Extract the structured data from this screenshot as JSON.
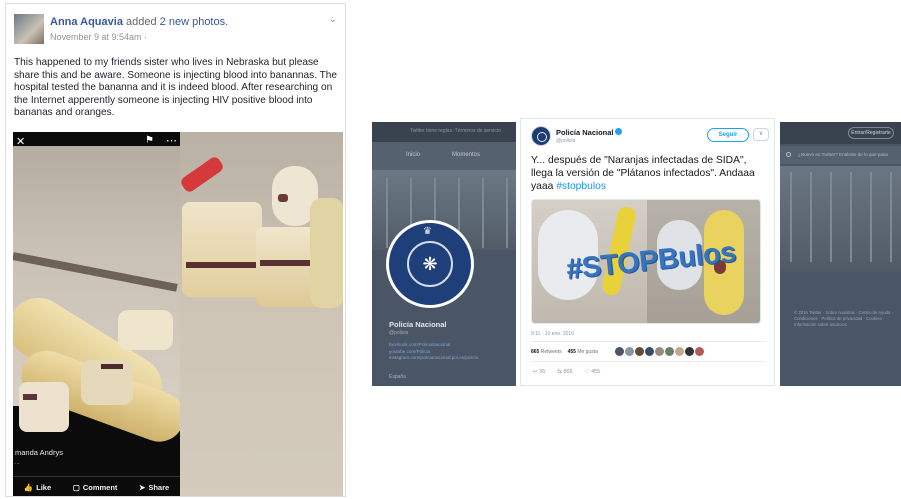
{
  "facebook_post": {
    "author": "Anna Aquavia",
    "action": "added",
    "photos_link": "2 new photos.",
    "timestamp": "November 9 at 9:54am ·",
    "body": "This happened to my friends sister who lives in Nebraska but please share this and be aware. Someone is injecting blood into banannas. The hospital tested the bananna and it is indeed blood. After researching on the Internet apperently someone is injecting HIV positive blood into bananas and oranges.",
    "photo_caption": "manda Andrys",
    "photo_subcaption": "...",
    "actions": [
      "Like",
      "Comment",
      "Share"
    ]
  },
  "twitter_profile": {
    "top_strip": "Twitter tiene reglas. Términos de servicio",
    "nav": [
      "Inicio",
      "Momentos"
    ],
    "profile_name": "Policía Nacional",
    "profile_handle": "@policia",
    "links": [
      "facebook.com/PoliciaNacional",
      "youtube.com/Policia",
      "instagram.com/policianacional.pol.es/policia"
    ],
    "location": "España"
  },
  "tweet": {
    "name": "Policía Nacional",
    "handle": "@policia",
    "follow_label": "Seguir",
    "caret": "v",
    "text_plain": "Y... después de \"Naranjas infectadas de SIDA\", llega la versión de \"Plátanos infectados\". Andaaa yaaa ",
    "hashtag": "#stopbulos",
    "media_stamp": "#STOPBulos",
    "time": "9:11 - 10 ene. 2016",
    "retweets_count": "865",
    "retweets_label": "Retweets",
    "likes_count": "455",
    "likes_label": "Me gusta",
    "reply_count": "36",
    "rt_count": "865",
    "like_count": "455"
  },
  "twitter_right": {
    "signup_label": "Entrar/Registrarte",
    "search_placeholder": "¿Nuevo en Twitter? Entérate de lo que pasa",
    "footer": "© 2016 Twitter · Sobre nosotros · Centro de Ayuda · Condiciones · Política de privacidad · Cookies · Información sobre anuncios"
  },
  "colors": {
    "fb_link": "#365899",
    "twitter_blue": "#1da1f2",
    "hashtag": "#1b95e0",
    "stamp": "#2f6fbf"
  }
}
